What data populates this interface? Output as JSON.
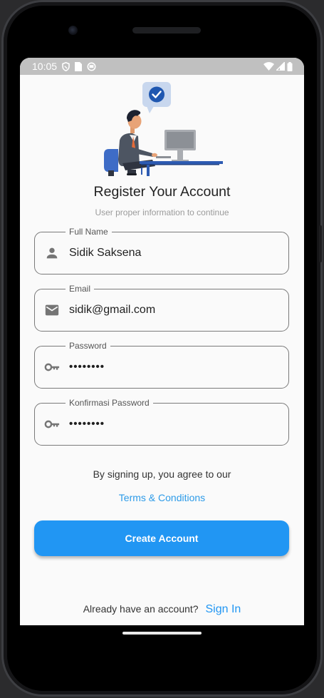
{
  "status_bar": {
    "time": "10:05",
    "left_icons": [
      "shield-icon",
      "sim-card-icon",
      "circle-status-icon"
    ],
    "right_icons": [
      "wifi-icon",
      "signal-icon",
      "battery-icon"
    ]
  },
  "header": {
    "title": "Register Your Account",
    "subtitle": "User proper information to continue"
  },
  "form": {
    "full_name": {
      "label": "Full Name",
      "value": "Sidik Saksena",
      "icon": "person-icon"
    },
    "email": {
      "label": "Email",
      "value": "sidik@gmail.com",
      "icon": "mail-icon"
    },
    "password": {
      "label": "Password",
      "value": "••••••••",
      "icon": "key-icon"
    },
    "confirm_password": {
      "label": "Konfirmasi Password",
      "value": "••••••••",
      "icon": "key-icon"
    }
  },
  "agreement": {
    "text": "By signing up, you agree to our",
    "link": "Terms & Conditions"
  },
  "actions": {
    "create_label": "Create Account"
  },
  "footer": {
    "prompt": "Already have an account?",
    "signin_label": "Sign In"
  },
  "colors": {
    "primary": "#2196f3",
    "link": "#2d9be8",
    "status_bar": "#c0c0c0",
    "background": "#fafafa"
  }
}
